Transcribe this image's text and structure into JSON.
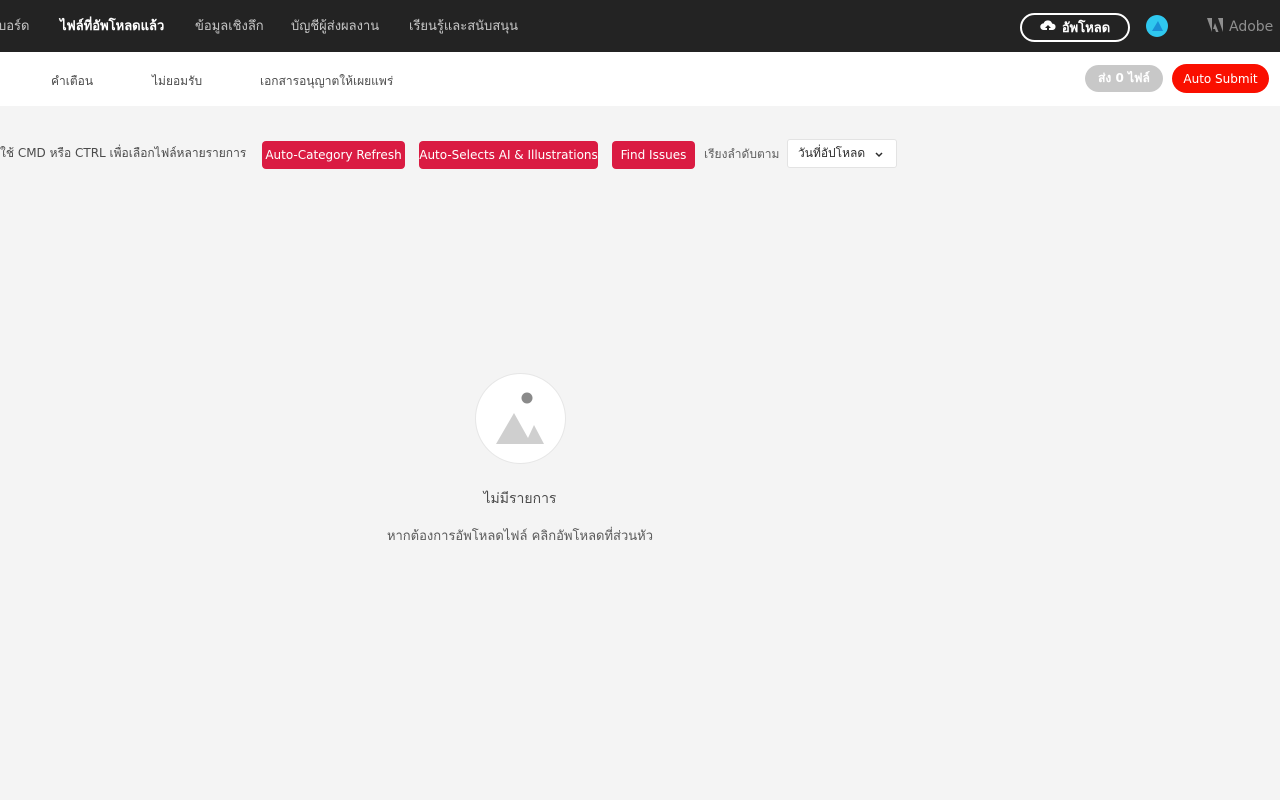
{
  "topnav": {
    "items": [
      {
        "label": "บอร์ด",
        "active": false
      },
      {
        "label": "ไฟล์ที่อัพโหลดแล้ว",
        "active": true
      },
      {
        "label": "ข้อมูลเชิงลึก",
        "active": false
      },
      {
        "label": "บัญชีผู้ส่งผลงาน",
        "active": false
      },
      {
        "label": "เรียนรู้และสนับสนุน",
        "active": false
      }
    ],
    "upload_label": "อัพโหลด",
    "adobe_label": "Adobe"
  },
  "subnav": {
    "tabs": [
      {
        "label": "คำเตือน"
      },
      {
        "label": "ไม่ยอมรับ"
      },
      {
        "label": "เอกสารอนุญาตให้เผยแพร่"
      }
    ],
    "send_label": "ส่ง 0 ไฟล์",
    "auto_submit_label": "Auto Submit"
  },
  "toolbar": {
    "hint": "ใช้ CMD หรือ CTRL เพื่อเลือกไฟล์หลายรายการ",
    "auto_category_label": "Auto-Category Refresh",
    "auto_selects_label": "Auto-Selects AI & Illustrations",
    "find_issues_label": "Find Issues",
    "sort_label": "เรียงลำดับตาม",
    "sort_value": "วันที่อัปโหลด"
  },
  "empty_state": {
    "title": "ไม่มีรายการ",
    "subtitle": "หากต้องการอัพโหลดไฟล์ คลิกอัพโหลดที่ส่วนหัว"
  },
  "colors": {
    "topnav_bg": "#232323",
    "accent_red": "#da1b42",
    "auto_submit_red": "#fa0f00",
    "avatar": "#2fc8ef"
  },
  "icons": [
    "cloud-upload-icon",
    "avatar",
    "adobe-logo-icon",
    "chevron-down-icon",
    "image-placeholder-icon"
  ]
}
